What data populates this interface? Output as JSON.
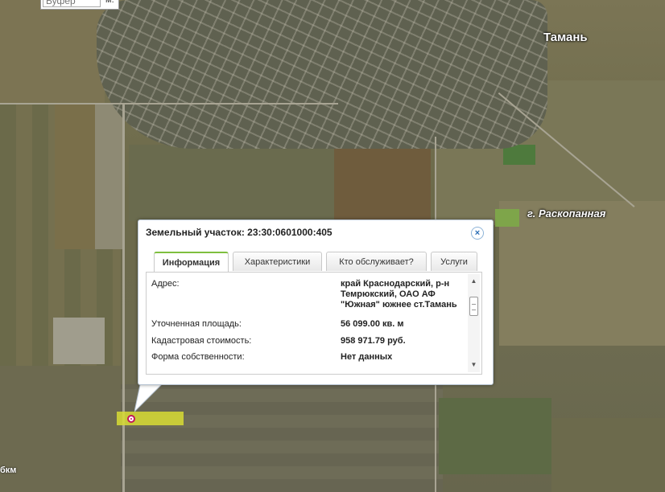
{
  "map": {
    "label_taman": "Тамань",
    "label_river": "г. Раскопанная",
    "scale_label": "бкм"
  },
  "buffer": {
    "placeholder": "Буфер",
    "unit": "м."
  },
  "popup": {
    "title": "Земельный участок: 23:30:0601000:405",
    "close_symbol": "×",
    "tabs": [
      {
        "label": "Информация",
        "active": true
      },
      {
        "label": "Характеристики",
        "active": false
      },
      {
        "label": "Кто обслуживает?",
        "active": false
      },
      {
        "label": "Услуги",
        "active": false
      }
    ],
    "rows": [
      {
        "label": "Адрес:",
        "value": "край Краснодарский, р-н Темрюкский, ОАО АФ \"Южная\" южнее ст.Тамань"
      },
      {
        "label": "Уточненная площадь:",
        "value": "56 099.00 кв. м"
      },
      {
        "label": "Кадастровая стоимость:",
        "value": "958 971.79 руб."
      },
      {
        "label": "Форма собственности:",
        "value": "Нет данных"
      }
    ],
    "scroll_up": "▲",
    "scroll_down": "▼"
  },
  "colors": {
    "active_tab_accent": "#7fbf3f",
    "parcel_highlight": "#d8dc34",
    "marker": "#c2185b"
  }
}
